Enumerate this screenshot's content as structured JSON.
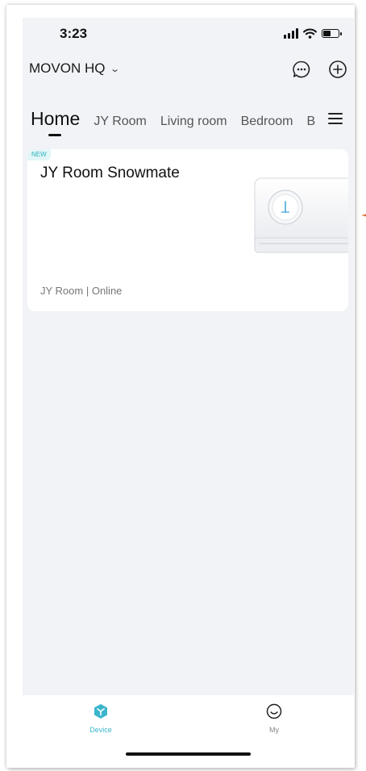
{
  "status_bar": {
    "time": "3:23"
  },
  "header": {
    "home_name": "MOVON HQ",
    "message_icon": "message-dots-icon",
    "add_icon": "plus-circle-icon"
  },
  "tabs": [
    {
      "label": "Home",
      "active": true
    },
    {
      "label": "JY Room"
    },
    {
      "label": "Living room"
    },
    {
      "label": "Bedroom"
    },
    {
      "label": "B"
    }
  ],
  "device_card": {
    "badge": "NEW",
    "name": "JY Room Snowmate",
    "status": "JY Room | Online",
    "image_icon": "air-conditioner-icon"
  },
  "bottom_nav": [
    {
      "label": "Device",
      "icon": "device-cube-icon",
      "active": true,
      "color": "#3bb5cc"
    },
    {
      "label": "My",
      "icon": "smile-face-icon"
    }
  ],
  "colors": {
    "accent": "#3bb5cc",
    "screen_bg": "#f2f3f7"
  }
}
